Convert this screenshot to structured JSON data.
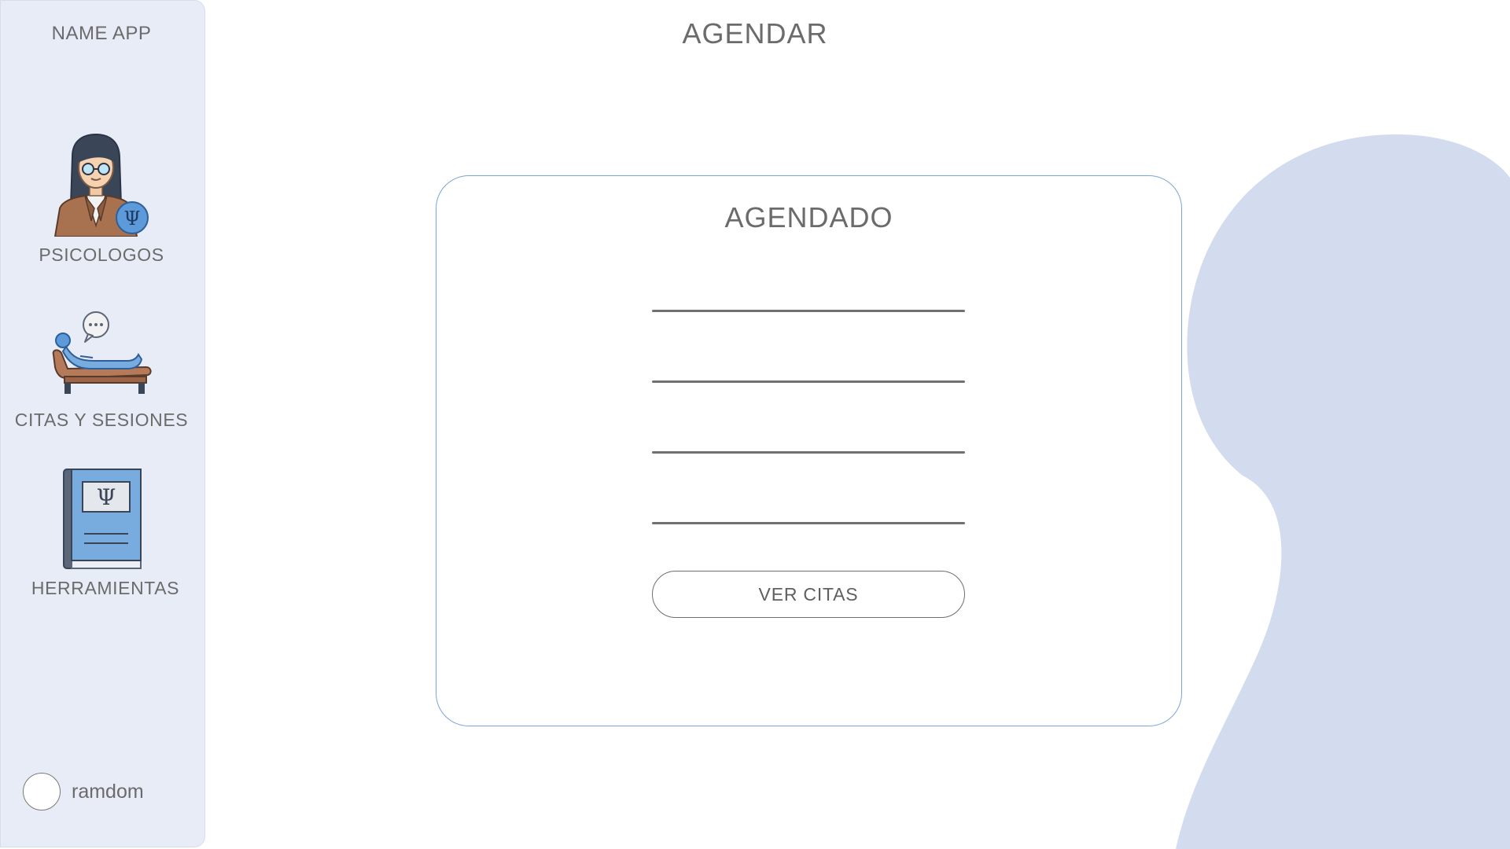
{
  "app": {
    "name": "NAME APP"
  },
  "sidebar": {
    "items": [
      {
        "label": "PSICOLOGOS",
        "icon": "psychologist-icon"
      },
      {
        "label": "CITAS Y SESIONES",
        "icon": "therapy-couch-icon"
      },
      {
        "label": "HERRAMIENTAS",
        "icon": "psychology-book-icon"
      }
    ],
    "user": {
      "name": "ramdom",
      "avatar_icon": "avatar"
    }
  },
  "header": {
    "title": "AGENDAR"
  },
  "card": {
    "title": "AGENDADO",
    "fields": [
      {
        "value": ""
      },
      {
        "value": ""
      },
      {
        "value": ""
      },
      {
        "value": ""
      }
    ],
    "button_label": "VER CITAS"
  },
  "colors": {
    "sidebar_bg": "#e8ecf7",
    "blob": "#d3dcef",
    "card_border": "#7aa6d6",
    "text": "#6b6b6b",
    "icon_blue": "#5d9ad9"
  }
}
